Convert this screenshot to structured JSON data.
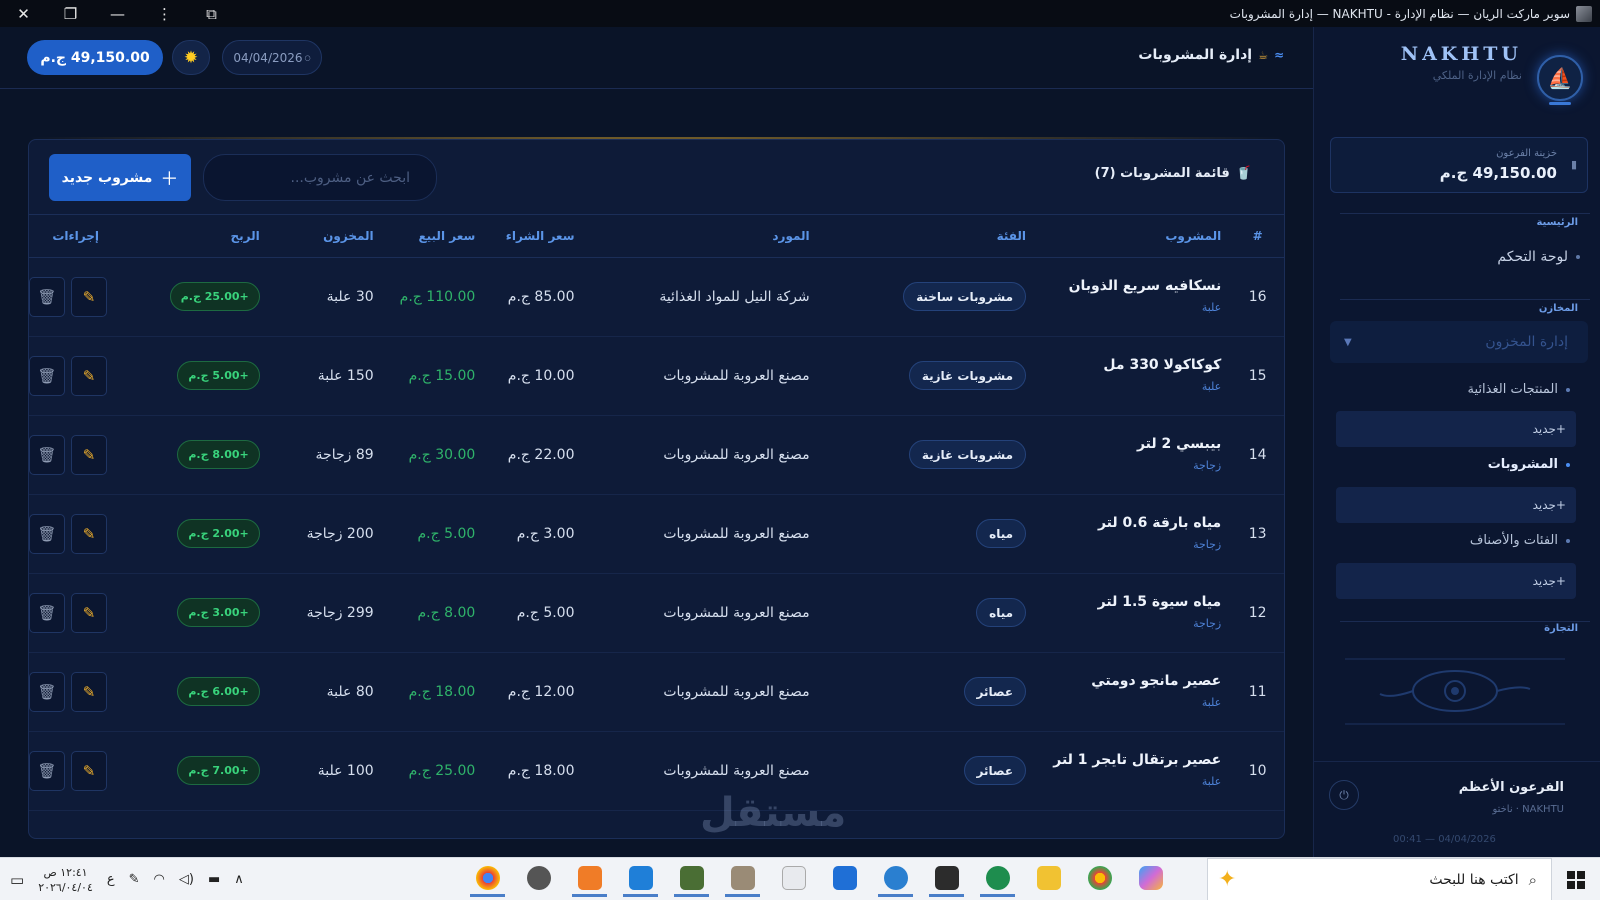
{
  "window": {
    "title": "سوبر ماركت الريان — نظام الإدارة - NAKHTU — إدارة المشروبات"
  },
  "sidebar": {
    "brand_name": "NAKHTU",
    "brand_sub": "نظام الإدارة الملكي",
    "treasury_label": "خزينة الفرعون",
    "treasury_value": "49,150.00 ج.م",
    "section_main": "الرئيسية",
    "dashboard": "لوحة التحكم",
    "section_stores": "المخازن",
    "inventory_group": "إدارة المخزون",
    "food_products": "المنتجات الغذائية",
    "beverages": "المشروبات",
    "categories": "الفئات والأصناف",
    "new_label": "+جديد",
    "section_trade": "التجارة",
    "user_name": "الفرعون الأعظم",
    "user_sub": "NAKHTU · ناختو",
    "user_time": "04/04/2026 — 00:41"
  },
  "topbar": {
    "page_title": "إدارة المشروبات",
    "date": "04/04/2026",
    "balance": "49,150.00 ج.م"
  },
  "list": {
    "title": "قائمة المشروبات (7)",
    "search_placeholder": "ابحث عن مشروب...",
    "add_button": "مشروب جديد",
    "headers": {
      "num": "#",
      "name": "المشروب",
      "category": "الفئة",
      "supplier": "المورد",
      "buy": "سعر الشراء",
      "sell": "سعر البيع",
      "stock": "المخزون",
      "profit": "الربح",
      "actions": "إجراءات"
    },
    "rows": [
      {
        "num": "16",
        "name": "نسكافيه سريع الذوبان",
        "unit": "علبة",
        "category": "مشروبات ساخنة",
        "supplier": "شركة النيل للمواد الغذائية",
        "buy": "85.00 ج.م",
        "sell": "110.00 ج.م",
        "stock": "30 علبة",
        "profit": "+25.00 ج.م"
      },
      {
        "num": "15",
        "name": "كوكاكولا 330 مل",
        "unit": "علبة",
        "category": "مشروبات غازية",
        "supplier": "مصنع العروبة للمشروبات",
        "buy": "10.00 ج.م",
        "sell": "15.00 ج.م",
        "stock": "150 علبة",
        "profit": "+5.00 ج.م"
      },
      {
        "num": "14",
        "name": "بيبسي 2 لتر",
        "unit": "زجاجة",
        "category": "مشروبات غازية",
        "supplier": "مصنع العروبة للمشروبات",
        "buy": "22.00 ج.م",
        "sell": "30.00 ج.م",
        "stock": "89 زجاجة",
        "profit": "+8.00 ج.م"
      },
      {
        "num": "13",
        "name": "مياه بارقة 0.6 لتر",
        "unit": "زجاجة",
        "category": "مياه",
        "supplier": "مصنع العروبة للمشروبات",
        "buy": "3.00 ج.م",
        "sell": "5.00 ج.م",
        "stock": "200 زجاجة",
        "profit": "+2.00 ج.م"
      },
      {
        "num": "12",
        "name": "مياه سيوة 1.5 لتر",
        "unit": "زجاجة",
        "category": "مياه",
        "supplier": "مصنع العروبة للمشروبات",
        "buy": "5.00 ج.م",
        "sell": "8.00 ج.م",
        "stock": "299 زجاجة",
        "profit": "+3.00 ج.م"
      },
      {
        "num": "11",
        "name": "عصير مانجو دومتي",
        "unit": "علبة",
        "category": "عصائر",
        "supplier": "مصنع العروبة للمشروبات",
        "buy": "12.00 ج.م",
        "sell": "18.00 ج.م",
        "stock": "80 علبة",
        "profit": "+6.00 ج.م"
      },
      {
        "num": "10",
        "name": "عصير برتقال تايجر 1 لتر",
        "unit": "علبة",
        "category": "عصائر",
        "supplier": "مصنع العروبة للمشروبات",
        "buy": "18.00 ج.م",
        "sell": "25.00 ج.م",
        "stock": "100 علبة",
        "profit": "+7.00 ج.م"
      }
    ]
  },
  "taskbar": {
    "search_text": "اكتب هنا للبحث",
    "time": "١٢:٤١ ص",
    "date": "٢٠٢٦/٠٤/٠٤",
    "lang": "ع"
  },
  "watermark": "مستقل"
}
